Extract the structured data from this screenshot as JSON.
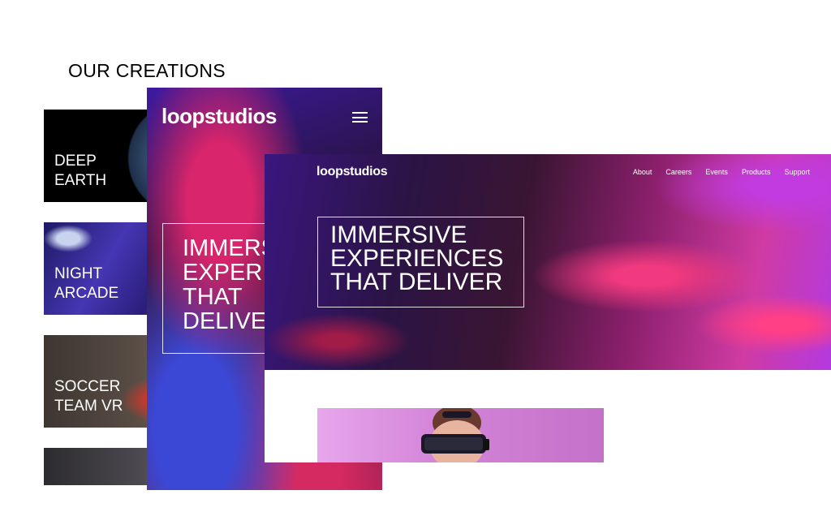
{
  "section": {
    "title": "OUR CREATIONS"
  },
  "creations": [
    {
      "label": "DEEP\nEARTH"
    },
    {
      "label": "NIGHT\nARCADE"
    },
    {
      "label": "SOCCER\nTEAM VR"
    },
    {
      "label": ""
    }
  ],
  "mobile": {
    "logo": "loopstudios",
    "menu_icon": "hamburger-icon",
    "hero_text": "IMMERSIVE\nEXPERIENCES\nTHAT\nDELIVER"
  },
  "desktop": {
    "logo": "loopstudios",
    "nav": [
      "About",
      "Careers",
      "Events",
      "Products",
      "Support"
    ],
    "hero_text": "IMMERSIVE\nEXPERIENCES\nTHAT DELIVER"
  },
  "colors": {
    "accent_pink": "#e63a86",
    "accent_purple": "#5a21b0",
    "text_dark": "#000000",
    "text_light": "#ffffff"
  }
}
